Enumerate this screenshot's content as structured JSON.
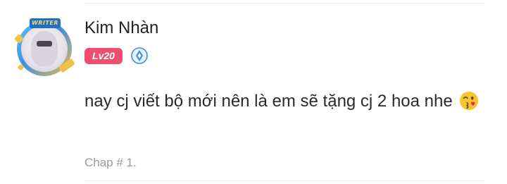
{
  "comment": {
    "user": {
      "name": "Kim Nhàn",
      "level": "Lv20",
      "avatar_badge": "WRITER",
      "rank_icon": "diamond-rank-icon"
    },
    "text": "nay cj viết bộ mới nên là em sẽ tặng cj 2 hoa nhe",
    "emoji": "kissing-wink-heart-emoji",
    "chapter": "Chap # 1."
  },
  "colors": {
    "level_badge": "#ef4f6f",
    "rank_icon": "#3b8fe0",
    "muted_text": "#9a9a9a"
  }
}
